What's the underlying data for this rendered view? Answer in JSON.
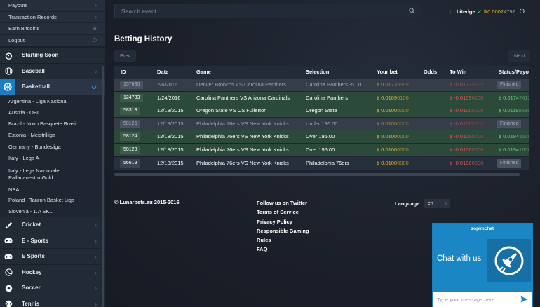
{
  "sidebar": {
    "account_items": [
      {
        "label": "Payouts",
        "icon": "chevron-right-icon",
        "glyph": "›"
      },
      {
        "label": "Transaction Records",
        "icon": "chevron-right-icon",
        "glyph": "›"
      },
      {
        "label": "Earn Bitcoins",
        "icon": "bitcoin-icon",
        "glyph": "฿"
      },
      {
        "label": "Logout",
        "icon": "power-icon",
        "glyph": "⏻"
      }
    ],
    "cat_starting_soon": "Starting Soon",
    "cat_baseball": "Baseball",
    "cat_basketball": "Basketball",
    "leagues": [
      "Argentina - Liga Nacional",
      "Austria - OBL",
      "Brazil - Novo Basquete Brasil",
      "Estonia - Meistriliiga",
      "Germany - Bundesliga",
      "Italy - Lega A",
      "Italy - Lega Nazionale Pallacanestro Gold",
      "NBA",
      "Poland - Tauron Basket Liga",
      "Slovenia - 1.A SKL"
    ],
    "cat_cricket": "Cricket",
    "cat_esports1": "E - Sports",
    "cat_esports2": "E Sports",
    "cat_hockey": "Hockey",
    "cat_soccer": "Soccer",
    "cat_tennis": "Tennis"
  },
  "header": {
    "search_placeholder": "Search event...",
    "username": "bitedge",
    "balance_main": "0.0002",
    "balance_rest": "4797"
  },
  "page": {
    "title": "Betting History",
    "prev_label": "Prev",
    "next_label": "Next"
  },
  "table": {
    "headers": {
      "id": "ID",
      "date": "Date",
      "game": "Game",
      "selection": "Selection",
      "bet": "Your bet",
      "odds": "Odds",
      "win": "To Win",
      "status": "Status/Payo"
    },
    "rows": [
      {
        "id": "157680",
        "date": "2/6/2016",
        "game": "Denver Broncos VS Carolina Panthers",
        "selection": "Carolina Panthers -5.00",
        "bet_main": "0.0173",
        "bet_rest": "9999",
        "win_main": "-0.0173",
        "win_rest": "9999",
        "status": "Finished",
        "payout_main": "",
        "payout_rest": ""
      },
      {
        "id": "124733",
        "date": "1/24/2016",
        "game": "Carolina Panthers VS Arizona Cardinals",
        "selection": "Carolina Panthers",
        "bet_main": "0.0109",
        "bet_rest": "6106",
        "win_main": "-0.0109",
        "win_rest": "6108",
        "status": "",
        "payout_main": "0.0174",
        "payout_rest": "7412"
      },
      {
        "id": "58313",
        "date": "12/18/2015",
        "game": "Oregon State VS CS Fullerton",
        "selection": "Oregon State",
        "bet_main": "0.0100",
        "bet_rest": "0000",
        "win_main": "-0.0100",
        "win_rest": "0000",
        "status": "",
        "payout_main": "0.0119",
        "payout_rest": "9688"
      },
      {
        "id": "58125",
        "date": "12/18/2015",
        "game": "Philadelphia 76ers VS New York Knicks",
        "selection": "Under 196.00",
        "bet_main": "0.0100",
        "bet_rest": "0000",
        "win_main": "-0.0100",
        "win_rest": "0000",
        "status": "Finished",
        "payout_main": "",
        "payout_rest": ""
      },
      {
        "id": "58124",
        "date": "12/18/2015",
        "game": "Philadelphia 76ers VS New York Knicks",
        "selection": "Over 196.00",
        "bet_main": "0.0100",
        "bet_rest": "0000",
        "win_main": "-0.0100",
        "win_rest": "0000",
        "status": "",
        "payout_main": "0.0194",
        "payout_rest": "1608"
      },
      {
        "id": "58123",
        "date": "12/18/2015",
        "game": "Philadelphia 76ers VS New York Knicks",
        "selection": "Over 196.00",
        "bet_main": "0.0100",
        "bet_rest": "0000",
        "win_main": "-0.0100",
        "win_rest": "0000",
        "status": "",
        "payout_main": "0.0194",
        "payout_rest": "1608"
      },
      {
        "id": "56619",
        "date": "12/18/2015",
        "game": "Philadelphia 76ers VS New York Knicks",
        "selection": "Philadelphia 76ers",
        "bet_main": "0.0100",
        "bet_rest": "0000",
        "win_main": "-0.0100",
        "win_rest": "0000",
        "status": "Finished",
        "payout_main": "",
        "payout_rest": ""
      }
    ]
  },
  "footer": {
    "copyright": "© Lunarbets.eu 2015-2016",
    "links": [
      "Follow us on Twitter",
      "Terms of Service",
      "Privacy Policy",
      "Responsible Gaming",
      "Rules",
      "FAQ"
    ],
    "language_label": "Language:",
    "language_value": "en"
  },
  "chat": {
    "brand": "zopimchat",
    "title": "Chat with us",
    "input_placeholder": "Type your message here"
  },
  "colors": {
    "accent_blue": "#1b7ec1",
    "win_green": "#5fcf78",
    "loss_red": "#e05552",
    "btc_gold": "#e1b32b",
    "chat_blue": "#1a86c4"
  }
}
